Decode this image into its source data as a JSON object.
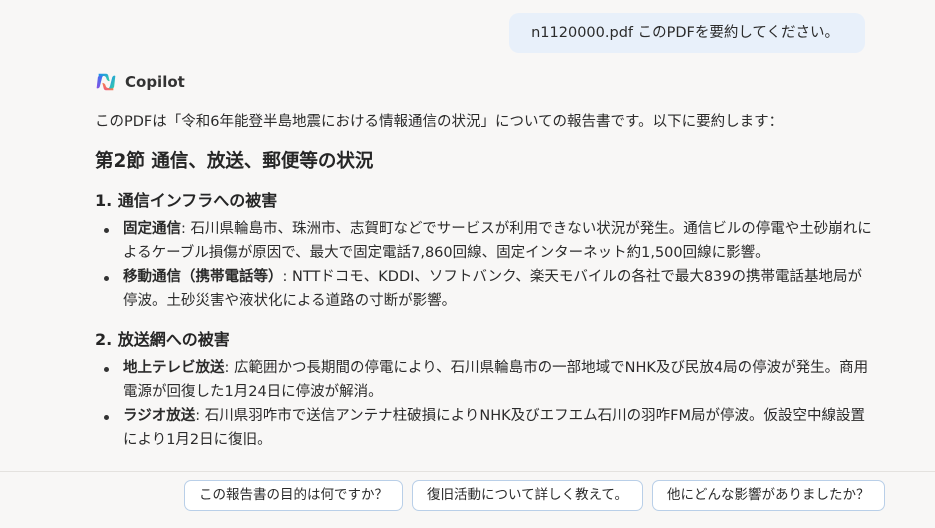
{
  "user_message": {
    "text": "n1120000.pdf このPDFを要約してください。"
  },
  "assistant": {
    "name": "Copilot",
    "logo_icon": "copilot-logo-icon",
    "intro": "このPDFは「令和6年能登半島地震における情報通信の状況」についての報告書です。以下に要約します：",
    "heading": "第2節 通信、放送、郵便等の状況",
    "sections": [
      {
        "title": "1. 通信インフラへの被害",
        "items": [
          {
            "term": "固定通信",
            "text": ": 石川県輪島市、珠洲市、志賀町などでサービスが利用できない状況が発生。通信ビルの停電や土砂崩れによるケーブル損傷が原因で、最大で固定電話7,860回線、固定インターネット約1,500回線に影響。"
          },
          {
            "term": "移動通信（携帯電話等）",
            "text": ": NTTドコモ、KDDI、ソフトバンク、楽天モバイルの各社で最大839の携帯電話基地局が停波。土砂災害や液状化による道路の寸断が影響。"
          }
        ]
      },
      {
        "title": "2. 放送網への被害",
        "items": [
          {
            "term": "地上テレビ放送",
            "text": ": 広範囲かつ長期間の停電により、石川県輪島市の一部地域でNHK及び民放4局の停波が発生。商用電源が回復した1月24日に停波が解消。"
          },
          {
            "term": "ラジオ放送",
            "text": ": 石川県羽咋市で送信アンテナ柱破損によりNHK及びエフエム石川の羽咋FM局が停波。仮設空中線設置により1月2日に復旧。"
          }
        ]
      }
    ]
  },
  "suggestions": [
    "この報告書の目的は何ですか？",
    "復旧活動について詳しく教えて。",
    "他にどんな影響がありましたか？"
  ],
  "colors": {
    "background": "#f8f7f6",
    "user_bubble": "#e8f0fa",
    "chip_border": "#b9cfe8"
  }
}
